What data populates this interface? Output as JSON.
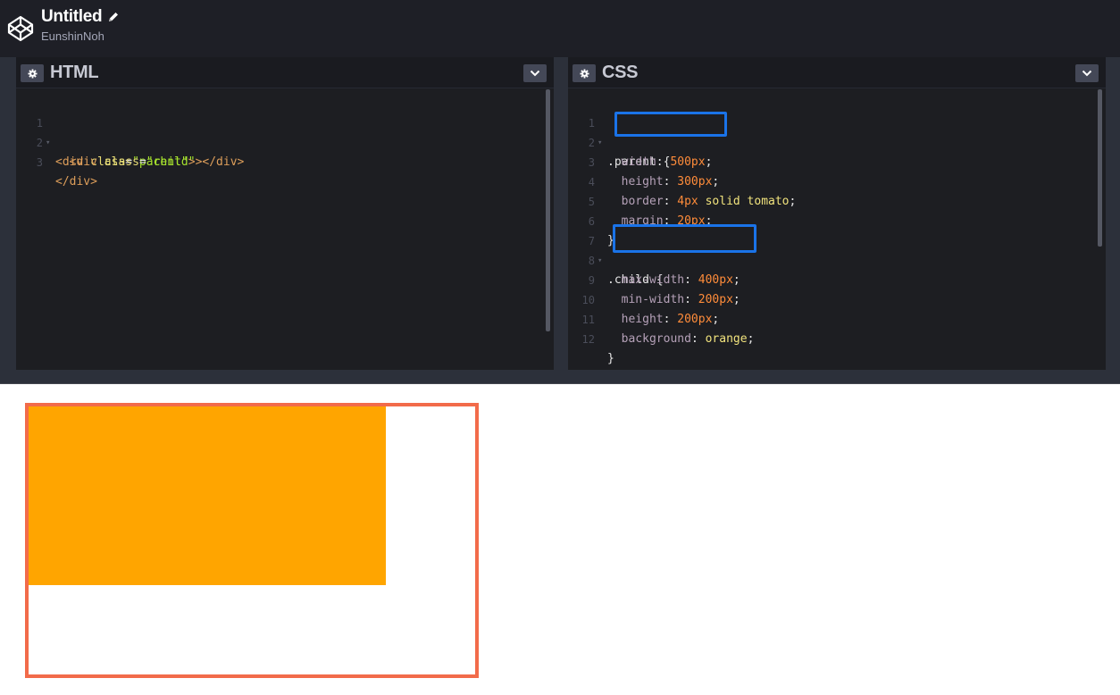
{
  "header": {
    "title": "Untitled",
    "author": "EunshinNoh"
  },
  "html_panel": {
    "title": "HTML",
    "lines": [
      {
        "n": "1",
        "fold": true
      },
      {
        "n": "2",
        "fold": false
      },
      {
        "n": "3",
        "fold": false
      }
    ],
    "code": {
      "l1": {
        "open": "<",
        "tag": "div",
        "sp": " ",
        "attr": "class",
        "eq": "=",
        "val": "\"parent\"",
        "close": ">"
      },
      "l2": {
        "indent": "  ",
        "open": "<",
        "tag": "div",
        "sp": " ",
        "attr": "class",
        "eq": "=",
        "val": "\"child\"",
        "close": "></",
        "tag2": "div",
        "close2": ">"
      },
      "l3": {
        "text": "</div>"
      }
    }
  },
  "css_panel": {
    "title": "CSS",
    "line_numbers": [
      "1",
      "2",
      "3",
      "4",
      "5",
      "6",
      "7",
      "8",
      "9",
      "10",
      "11",
      "12"
    ],
    "code": {
      "l1_sel": ".parent",
      "l1_brace": " {",
      "l2_prop": "width",
      "l2_val": "500px",
      "l3_prop": "height",
      "l3_val": "300px",
      "l4_prop": "border",
      "l4_val_num": "4px",
      "l4_val_rest": "solid tomato",
      "l5_prop": "margin",
      "l5_val": "20px",
      "l6": "}",
      "l7_sel": ".child",
      "l7_brace": " {",
      "l8_prop": "max-width",
      "l8_val": "400px",
      "l9_prop": "min-width",
      "l9_val": "200px",
      "l10_prop": "height",
      "l10_val": "200px",
      "l11_prop": "background",
      "l11_val": "orange",
      "l12": "}"
    }
  },
  "colors": {
    "highlight": "#1a73e8",
    "parent_border": "#f26b4a",
    "child_background": "#ffa500"
  }
}
